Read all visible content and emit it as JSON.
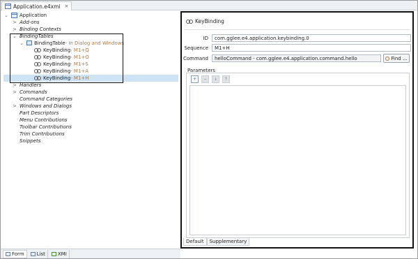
{
  "editor_tab": {
    "title": "Application.e4xmi",
    "close": "×"
  },
  "tree": {
    "root": "Application",
    "items": [
      {
        "label": "Add-ons",
        "twisty": ">"
      },
      {
        "label": "Binding Contexts",
        "twisty": ""
      },
      {
        "label": "BindingTables",
        "twisty": "⌄"
      },
      {
        "label": "BindingTable",
        "suffix": " - In Dialog and Windows",
        "twisty": "⌄"
      },
      {
        "label": "KeyBinding",
        "suffix": " - M1+Q"
      },
      {
        "label": "KeyBinding",
        "suffix": " - M1+O"
      },
      {
        "label": "KeyBinding",
        "suffix": " - M1+S"
      },
      {
        "label": "KeyBinding",
        "suffix": " - M1+A"
      },
      {
        "label": "KeyBinding",
        "suffix": " - M1+H"
      },
      {
        "label": "Handlers",
        "twisty": ">"
      },
      {
        "label": "Commands",
        "twisty": ">"
      },
      {
        "label": "Command Categories",
        "twisty": ""
      },
      {
        "label": "Windows and Dialogs",
        "twisty": ">"
      },
      {
        "label": "Part Descriptors",
        "twisty": ""
      },
      {
        "label": "Menu Contributions",
        "twisty": ""
      },
      {
        "label": "Toolbar Contributions",
        "twisty": ""
      },
      {
        "label": "Trim Contributions",
        "twisty": ""
      },
      {
        "label": "Snippets",
        "twisty": ""
      }
    ]
  },
  "bottom_tabs": [
    "Form",
    "List",
    "XMI"
  ],
  "detail": {
    "title": "KeyBinding",
    "id_label": "ID",
    "id_value": "com.gglee.e4.application.keybinding.0",
    "sequence_label": "Sequence",
    "sequence_value": "M1+H",
    "command_label": "Command",
    "command_value": "helloCommand - com.gglee.e4.application.command.hello",
    "find_label": "Find ...",
    "parameters_label": "Parameters",
    "tabs": [
      "Default",
      "Supplementary"
    ]
  }
}
